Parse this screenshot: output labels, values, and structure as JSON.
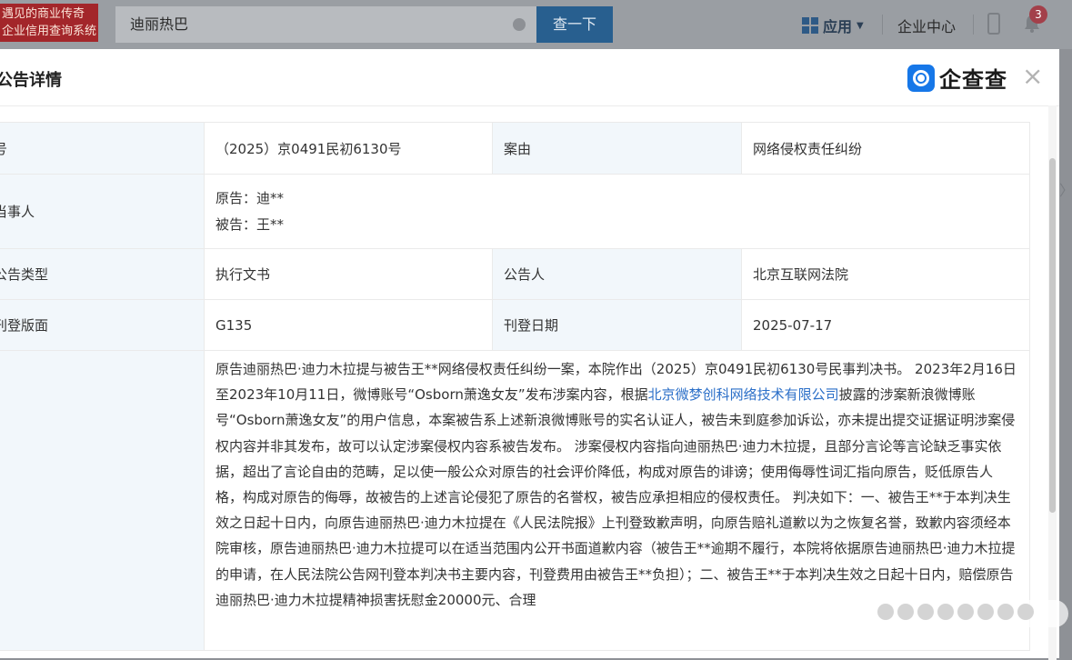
{
  "topbar": {
    "logo_line1": "遇见的商业传奇",
    "logo_line2": "企业信用查询系统",
    "search_value": "迪丽热巴",
    "search_button": "查一下",
    "apps_label": "应用",
    "enterprise_center": "企业中心",
    "notification_count": "3"
  },
  "modal": {
    "title": "公告详情",
    "brand": "企查查",
    "close": "×"
  },
  "fields": {
    "case_no_label": "号",
    "case_no": "（2025）京0491民初6130号",
    "cause_label": "案由",
    "cause": "网络侵权责任纠纷",
    "party_label": "当事人",
    "plaintiff": "原告：迪**",
    "defendant": "被告：王**",
    "type_label": "公告类型",
    "type": "执行文书",
    "announcer_label": "公告人",
    "announcer": "北京互联网法院",
    "page_label": "刊登版面",
    "page": "G135",
    "date_label": "刊登日期",
    "date": "2025-07-17",
    "content_label": "",
    "content_part1": "原告迪丽热巴·迪力木拉提与被告王**网络侵权责任纠纷一案，本院作出（2025）京0491民初6130号民事判决书。 2023年2月16日至2023年10月11日，微博账号“Osborn萧逸女友”发布涉案内容，根据",
    "content_link": "北京微梦创科网络技术有限公司",
    "content_part2": "披露的涉案新浪微博账号“Osborn萧逸女友”的用户信息，本案被告系上述新浪微博账号的实名认证人，被告未到庭参加诉讼，亦未提出提交证据证明涉案侵权内容并非其发布，故可以认定涉案侵权内容系被告发布。 涉案侵权内容指向迪丽热巴·迪力木拉提，且部分言论等言论缺乏事实依据，超出了言论自由的范畴，足以使一般公众对原告的社会评价降低，构成对原告的诽谤；使用侮辱性词汇指向原告，贬低原告人格，构成对原告的侮辱，故被告的上述言论侵犯了原告的名誉权，被告应承担相应的侵权责任。 判决如下：一、被告王**于本判决生效之日起十日内，向原告迪丽热巴·迪力木拉提在《人民法院报》上刊登致歉声明，向原告赔礼道歉以为之恢复名誉，致歉内容须经本院审核，原告迪丽热巴·迪力木拉提可以在适当范围内公开书面道歉内容（被告王**逾期不履行，本院将依据原告迪丽热巴·迪力木拉提的申请，在人民法院公告网刊登本判决书主要内容，刊登费用由被告王**负担）；二、被告王**于本判决生效之日起十日内，赔偿原告迪丽热巴·迪力木拉提精神损害抚慰金20000元、合理"
  }
}
